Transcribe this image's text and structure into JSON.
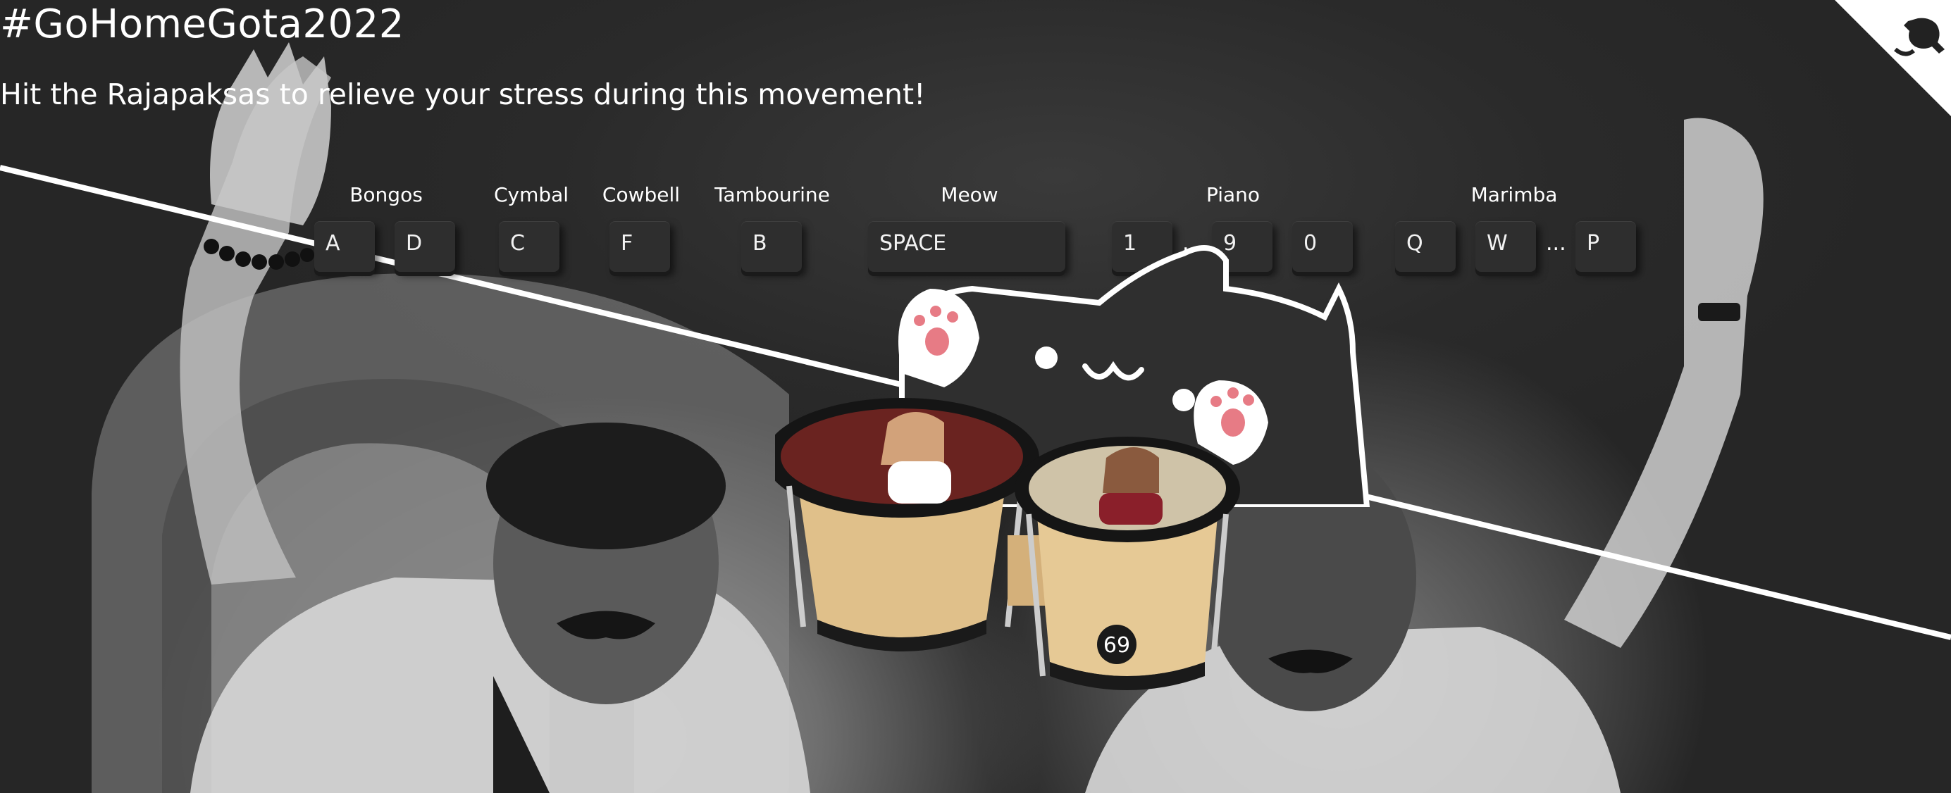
{
  "header": {
    "title": "#GoHomeGota2022",
    "subtitle": "Hit the Rajapaksas to relieve your stress during this movement!"
  },
  "instruments": [
    {
      "label": "Bongos",
      "keys": [
        "A",
        "D"
      ]
    },
    {
      "label": "Cymbal",
      "keys": [
        "C"
      ]
    },
    {
      "label": "Cowbell",
      "keys": [
        "F"
      ]
    },
    {
      "label": "Tambourine",
      "keys": [
        "B"
      ]
    },
    {
      "label": "Meow",
      "keys": [
        "SPACE"
      ]
    },
    {
      "label": "Piano",
      "keys": [
        "1",
        "9",
        "0"
      ],
      "separator": "..."
    },
    {
      "label": "Marimba",
      "keys": [
        "Q",
        "W",
        "P"
      ],
      "separator": "..."
    }
  ],
  "bongo_drum_number": "69",
  "icons": {
    "corner": "github-octocat-icon",
    "cat": "bongo-cat-icon",
    "drums": "bongo-drums-icon"
  },
  "colors": {
    "text": "#ffffff",
    "key_bg": "#2e2e2e",
    "background": "#2a2a2a"
  }
}
